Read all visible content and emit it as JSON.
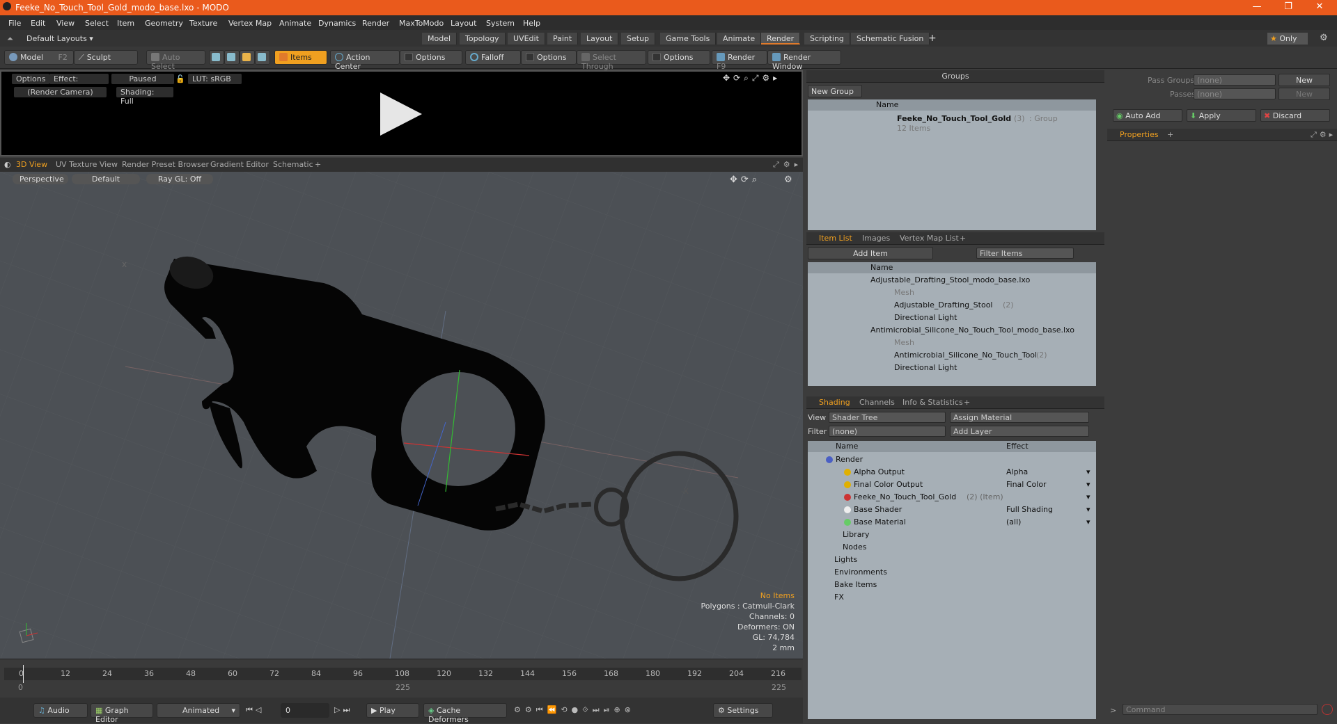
{
  "window": {
    "title": "Feeke_No_Touch_Tool_Gold_modo_base.lxo - MODO"
  },
  "menu": [
    "File",
    "Edit",
    "View",
    "Select",
    "Item",
    "Geometry",
    "Texture",
    "Vertex Map",
    "Animate",
    "Dynamics",
    "Render",
    "MaxToModo",
    "Layout",
    "System",
    "Help"
  ],
  "layout": {
    "selector": "Default Layouts ▾",
    "tabs": [
      "Model",
      "Topology",
      "UVEdit",
      "Paint",
      "Layout",
      "Setup",
      "Game Tools",
      "Animate",
      "Render",
      "Scripting",
      "Schematic Fusion"
    ],
    "active_tab": "Render",
    "only_label": "Only"
  },
  "toolbar": {
    "model": "Model",
    "model_key": "F2",
    "sculpt": "Sculpt",
    "auto_select": "Auto Select",
    "items": "Items",
    "action_center": "Action Center",
    "options1": "Options",
    "falloff": "Falloff",
    "options2": "Options",
    "select_through": "Select Through",
    "options3": "Options",
    "render": "Render",
    "render_key": "F9",
    "render_window": "Render Window"
  },
  "preview": {
    "options": "Options",
    "effect": "Effect: (Shadi...",
    "paused": "Paused",
    "lut": "LUT: sRGB",
    "camera": "(Render Camera)",
    "shading": "Shading: Full"
  },
  "viewport_tabs": [
    "3D View",
    "UV Texture View",
    "Render Preset Browser",
    "Gradient Editor",
    "Schematic",
    "+"
  ],
  "viewport": {
    "perspective": "Perspective",
    "default": "Default",
    "raygl": "Ray GL: Off",
    "info": {
      "no_items": "No Items",
      "polygons": "Polygons : Catmull-Clark",
      "channels": "Channels: 0",
      "deformers": "Deformers: ON",
      "gl": "GL: 74,784",
      "scale": "2 mm"
    }
  },
  "timeline": {
    "ticks": [
      "0",
      "12",
      "24",
      "36",
      "48",
      "60",
      "72",
      "84",
      "96",
      "108",
      "120",
      "132",
      "144",
      "156",
      "168",
      "180",
      "192",
      "204",
      "216"
    ],
    "start": "0",
    "mid": "225",
    "end": "225"
  },
  "bottombar": {
    "audio": "Audio",
    "graph_editor": "Graph Editor",
    "animated": "Animated",
    "frame": "0",
    "play": "Play",
    "cache_deformers": "Cache Deformers",
    "settings": "Settings"
  },
  "groups": {
    "title": "Groups",
    "new_group": "New Group",
    "col_name": "Name",
    "item_name": "Feeke_No_Touch_Tool_Gold",
    "item_count": "(3)",
    "item_type": ": Group",
    "item_sub": "12 Items"
  },
  "itemlist": {
    "tabs": [
      "Item List",
      "Images",
      "Vertex Map List",
      "+"
    ],
    "add_item": "Add Item",
    "filter": "Filter Items",
    "col_name": "Name",
    "rows": [
      {
        "label": "Adjustable_Drafting_Stool_modo_base.lxo",
        "suffix": "",
        "dim": false
      },
      {
        "label": "Mesh",
        "suffix": "",
        "dim": true
      },
      {
        "label": "Adjustable_Drafting_Stool",
        "suffix": "(2)",
        "dim": false
      },
      {
        "label": "Directional Light",
        "suffix": "",
        "dim": false
      },
      {
        "label": "Antimicrobial_Silicone_No_Touch_Tool_modo_base.lxo",
        "suffix": "",
        "dim": false
      },
      {
        "label": "Mesh",
        "suffix": "",
        "dim": true
      },
      {
        "label": "Antimicrobial_Silicone_No_Touch_Tool",
        "suffix": "(2)",
        "dim": false
      },
      {
        "label": "Directional Light",
        "suffix": "",
        "dim": false
      }
    ]
  },
  "shading": {
    "tabs": [
      "Shading",
      "Channels",
      "Info & Statistics",
      "+"
    ],
    "view_label": "View",
    "view_value": "Shader Tree",
    "assign_material": "Assign Material",
    "filter_label": "Filter",
    "filter_value": "(none)",
    "add_layer": "Add Layer",
    "col_name": "Name",
    "col_effect": "Effect",
    "rows": [
      {
        "label": "Render",
        "effect": ""
      },
      {
        "label": "Alpha Output",
        "effect": "Alpha"
      },
      {
        "label": "Final Color Output",
        "effect": "Final Color"
      },
      {
        "label": "Feeke_No_Touch_Tool_Gold",
        "suffix": "(2) (Item)",
        "effect": ""
      },
      {
        "label": "Base Shader",
        "effect": "Full Shading"
      },
      {
        "label": "Base Material",
        "effect": "(all)"
      },
      {
        "label": "Library",
        "effect": ""
      },
      {
        "label": "Nodes",
        "effect": ""
      },
      {
        "label": "Lights",
        "effect": ""
      },
      {
        "label": "Environments",
        "effect": ""
      },
      {
        "label": "Bake Items",
        "effect": ""
      },
      {
        "label": "FX",
        "effect": ""
      }
    ]
  },
  "right": {
    "pass_groups": "Pass Groups",
    "passes": "Passes",
    "none": "(none)",
    "new": "New",
    "auto_add": "Auto Add",
    "apply": "Apply",
    "discard": "Discard",
    "properties": "Properties",
    "command": "Command"
  }
}
